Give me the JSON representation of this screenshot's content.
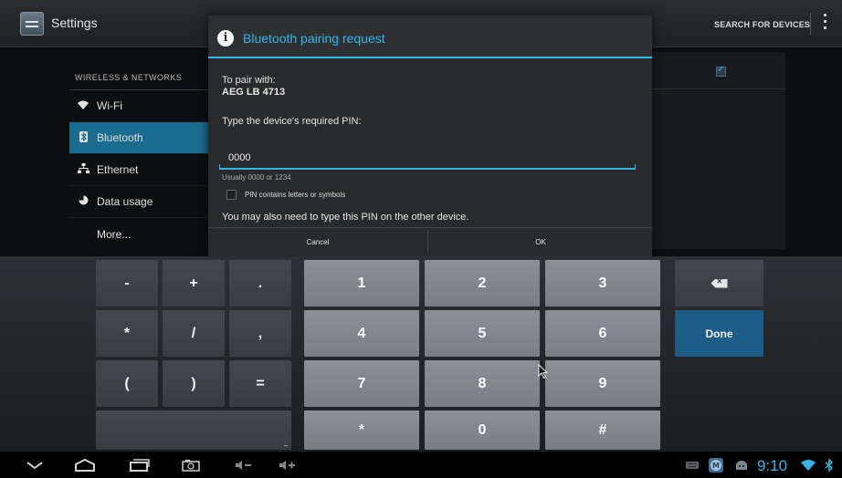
{
  "actionbar": {
    "title": "Settings",
    "search_label": "SEARCH FOR DEVICES"
  },
  "nav": {
    "section_header": "WIRELESS & NETWORKS",
    "items": [
      {
        "label": "Wi-Fi",
        "icon": "wifi-icon",
        "active": false
      },
      {
        "label": "Bluetooth",
        "icon": "bluetooth-icon",
        "active": true
      },
      {
        "label": "Ethernet",
        "icon": "ethernet-icon",
        "active": false
      },
      {
        "label": "Data usage",
        "icon": "data-usage-icon",
        "active": false
      },
      {
        "label": "More...",
        "icon": "",
        "active": false
      }
    ]
  },
  "dialog": {
    "title": "Bluetooth pairing request",
    "pair_with_label": "To pair with:",
    "device_name": "AEG LB 4713",
    "pin_prompt": "Type the device's required PIN:",
    "pin_value": "0000",
    "pin_hint": "Usually 0000 or 1234",
    "checkbox_label": "PIN contains letters or symbols",
    "checkbox_checked": false,
    "note": "You may also need to type this PIN on the other device.",
    "cancel_label": "Cancel",
    "ok_label": "OK"
  },
  "keyboard": {
    "symbol_keys": [
      "-",
      "+",
      ".",
      "*",
      "/",
      ",",
      "(",
      ")",
      "="
    ],
    "number_keys": [
      "1",
      "2",
      "3",
      "4",
      "5",
      "6",
      "7",
      "8",
      "9",
      "*",
      "0",
      "#"
    ],
    "done_label": "Done"
  },
  "statusbar": {
    "time": "9:10"
  },
  "colors": {
    "accent": "#33b5e5",
    "active_nav": "#1b6b8f",
    "done_key": "#1d5c87"
  }
}
